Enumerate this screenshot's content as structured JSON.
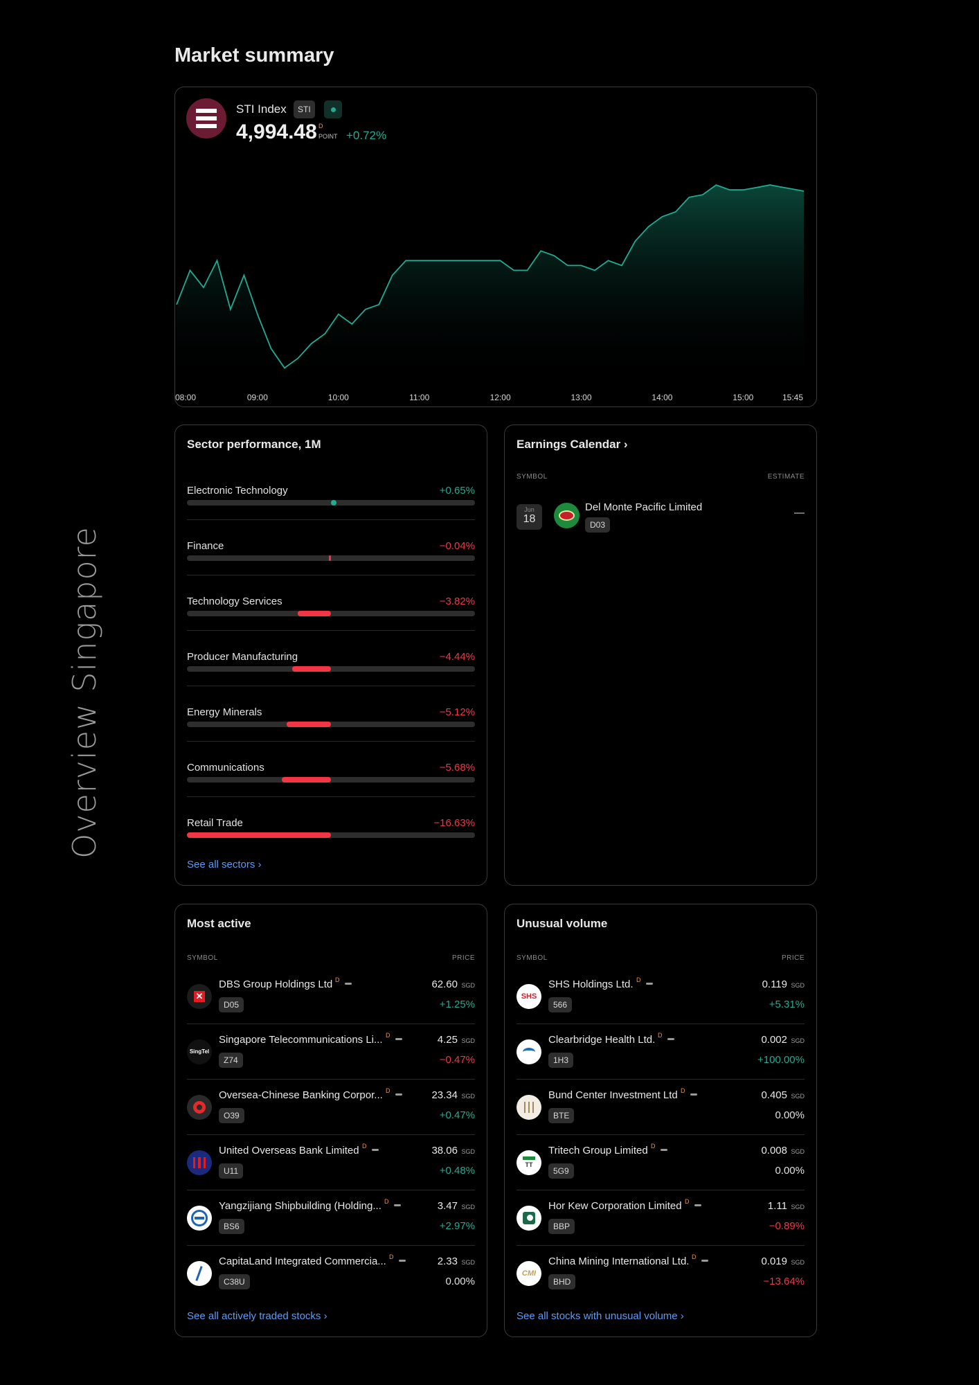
{
  "side_label": "Overview Singapore",
  "page_title": "Market summary",
  "index": {
    "name": "STI Index",
    "ticker": "STI",
    "price": "4,994.48",
    "d_marker": "D",
    "unit": "POINT",
    "change": "+0.72%",
    "colors": {
      "line": "#22ab94",
      "fill_top": "#0c4d3f"
    }
  },
  "chart_data": {
    "type": "area",
    "x_ticks": [
      "08:00",
      "09:00",
      "10:00",
      "11:00",
      "12:00",
      "13:00",
      "14:00",
      "15:00",
      "15:45"
    ],
    "x": [
      "08:00",
      "08:10",
      "08:20",
      "08:30",
      "08:40",
      "08:50",
      "09:00",
      "09:10",
      "09:20",
      "09:30",
      "09:40",
      "09:50",
      "10:00",
      "10:10",
      "10:20",
      "10:30",
      "10:40",
      "10:50",
      "11:00",
      "11:10",
      "11:20",
      "11:30",
      "11:40",
      "11:50",
      "12:00",
      "12:10",
      "12:20",
      "12:30",
      "12:40",
      "12:50",
      "13:00",
      "13:10",
      "13:20",
      "13:30",
      "13:40",
      "13:50",
      "14:00",
      "14:10",
      "14:20",
      "14:30",
      "14:40",
      "14:50",
      "15:00",
      "15:10",
      "15:20",
      "15:30",
      "15:40",
      "15:45"
    ],
    "y": [
      4948,
      4962,
      4955,
      4966,
      4946,
      4960,
      4944,
      4930,
      4922,
      4926,
      4932,
      4936,
      4944,
      4940,
      4946,
      4948,
      4960,
      4966,
      4966,
      4966,
      4966,
      4966,
      4966,
      4966,
      4966,
      4962,
      4962,
      4970,
      4968,
      4964,
      4964,
      4962,
      4966,
      4964,
      4974,
      4980,
      4984,
      4986,
      4992,
      4993,
      4997,
      4995,
      4995,
      4996,
      4997,
      4996,
      4995,
      4994.48
    ],
    "ylim": [
      4915,
      5003
    ],
    "grid": false,
    "legend": "none"
  },
  "sectors": {
    "title": "Sector performance, 1M",
    "items": [
      {
        "name": "Electronic Technology",
        "change": "+0.65%",
        "value": 0.65
      },
      {
        "name": "Finance",
        "change": "−0.04%",
        "value": -0.04
      },
      {
        "name": "Technology Services",
        "change": "−3.82%",
        "value": -3.82
      },
      {
        "name": "Producer Manufacturing",
        "change": "−4.44%",
        "value": -4.44
      },
      {
        "name": "Energy Minerals",
        "change": "−5.12%",
        "value": -5.12
      },
      {
        "name": "Communications",
        "change": "−5.68%",
        "value": -5.68
      },
      {
        "name": "Retail Trade",
        "change": "−16.63%",
        "value": -16.63
      }
    ],
    "link": "See all sectors ›"
  },
  "earnings": {
    "title": "Earnings Calendar ›",
    "col_symbol": "SYMBOL",
    "col_estimate": "ESTIMATE",
    "rows": [
      {
        "month": "Jun",
        "day": "18",
        "name": "Del Monte Pacific Limited",
        "ticker": "D03",
        "estimate": "—"
      }
    ]
  },
  "most_active": {
    "title": "Most active",
    "col_symbol": "SYMBOL",
    "col_price": "PRICE",
    "rows": [
      {
        "name": "DBS Group Holdings Ltd",
        "ticker": "D05",
        "price": "62.60",
        "currency": "SGD",
        "change": "+1.25%",
        "dir": "pos",
        "logo": "dbs-logo"
      },
      {
        "name": "Singapore Telecommunications Li...",
        "ticker": "Z74",
        "price": "4.25",
        "currency": "SGD",
        "change": "−0.47%",
        "dir": "neg",
        "logo": "singtel-logo"
      },
      {
        "name": "Oversea-Chinese Banking Corpor...",
        "ticker": "O39",
        "price": "23.34",
        "currency": "SGD",
        "change": "+0.47%",
        "dir": "pos",
        "logo": "ocbc-logo"
      },
      {
        "name": "United Overseas Bank Limited",
        "ticker": "U11",
        "price": "38.06",
        "currency": "SGD",
        "change": "+0.48%",
        "dir": "pos",
        "logo": "uob-logo"
      },
      {
        "name": "Yangzijiang Shipbuilding (Holding...",
        "ticker": "BS6",
        "price": "3.47",
        "currency": "SGD",
        "change": "+2.97%",
        "dir": "pos",
        "logo": "yzj-logo"
      },
      {
        "name": "CapitaLand Integrated Commercia...",
        "ticker": "C38U",
        "price": "2.33",
        "currency": "SGD",
        "change": "0.00%",
        "dir": "neu",
        "logo": "capitaland-logo"
      }
    ],
    "d_marker": "D",
    "link": "See all actively traded stocks ›"
  },
  "unusual_volume": {
    "title": "Unusual volume",
    "col_symbol": "SYMBOL",
    "col_price": "PRICE",
    "rows": [
      {
        "name": "SHS Holdings Ltd.",
        "ticker": "566",
        "price": "0.119",
        "currency": "SGD",
        "change": "+5.31%",
        "dir": "pos",
        "logo": "shs-logo"
      },
      {
        "name": "Clearbridge Health Ltd.",
        "ticker": "1H3",
        "price": "0.002",
        "currency": "SGD",
        "change": "+100.00%",
        "dir": "pos",
        "logo": "clearbridge-logo"
      },
      {
        "name": "Bund Center Investment Ltd",
        "ticker": "BTE",
        "price": "0.405",
        "currency": "SGD",
        "change": "0.00%",
        "dir": "neu",
        "logo": "bund-logo"
      },
      {
        "name": "Tritech Group Limited",
        "ticker": "5G9",
        "price": "0.008",
        "currency": "SGD",
        "change": "0.00%",
        "dir": "neu",
        "logo": "tritech-logo"
      },
      {
        "name": "Hor Kew Corporation Limited",
        "ticker": "BBP",
        "price": "1.11",
        "currency": "SGD",
        "change": "−0.89%",
        "dir": "neg",
        "logo": "horkew-logo"
      },
      {
        "name": "China Mining International Ltd.",
        "ticker": "BHD",
        "price": "0.019",
        "currency": "SGD",
        "change": "−13.64%",
        "dir": "neg",
        "logo": "cmi-logo"
      }
    ],
    "d_marker": "D",
    "link": "See all stocks with unusual volume ›"
  }
}
